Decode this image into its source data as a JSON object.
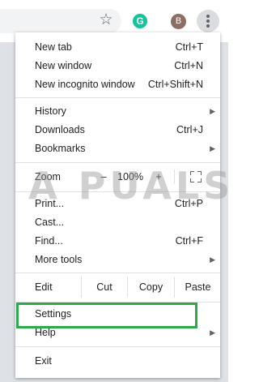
{
  "toolbar": {
    "star_icon": "star-icon",
    "grammarly_letter": "G",
    "avatar_letter": "B"
  },
  "menu": {
    "new_tab": {
      "label": "New tab",
      "shortcut": "Ctrl+T"
    },
    "new_window": {
      "label": "New window",
      "shortcut": "Ctrl+N"
    },
    "new_incognito": {
      "label": "New incognito window",
      "shortcut": "Ctrl+Shift+N"
    },
    "history": {
      "label": "History"
    },
    "downloads": {
      "label": "Downloads",
      "shortcut": "Ctrl+J"
    },
    "bookmarks": {
      "label": "Bookmarks"
    },
    "zoom": {
      "label": "Zoom",
      "minus": "–",
      "value": "100%",
      "plus": "+"
    },
    "print": {
      "label": "Print...",
      "shortcut": "Ctrl+P"
    },
    "cast": {
      "label": "Cast..."
    },
    "find": {
      "label": "Find...",
      "shortcut": "Ctrl+F"
    },
    "more_tools": {
      "label": "More tools"
    },
    "edit": {
      "label": "Edit",
      "cut": "Cut",
      "copy": "Copy",
      "paste": "Paste"
    },
    "settings": {
      "label": "Settings"
    },
    "help": {
      "label": "Help"
    },
    "exit": {
      "label": "Exit"
    }
  },
  "watermark": {
    "text": "A PUALS"
  },
  "highlight_color": "#2ea84b"
}
